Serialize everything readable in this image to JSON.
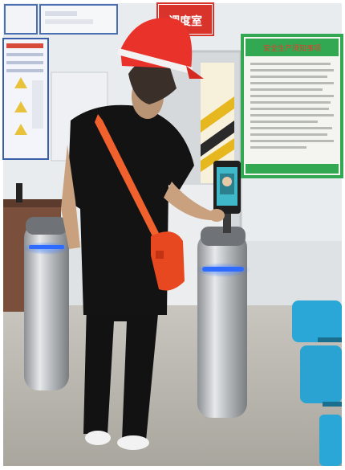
{
  "sign": {
    "room_label": "调度室"
  },
  "notice_board": {
    "heading": "安全生产须知事项"
  },
  "colors": {
    "wall": "#e9ecef",
    "floor": "#b9b6ae",
    "helmet": "#e8322a",
    "shirt": "#121212",
    "turnstile_light": "#2f6bff",
    "chair": "#2aa7d6",
    "notice_border": "#33a852"
  }
}
